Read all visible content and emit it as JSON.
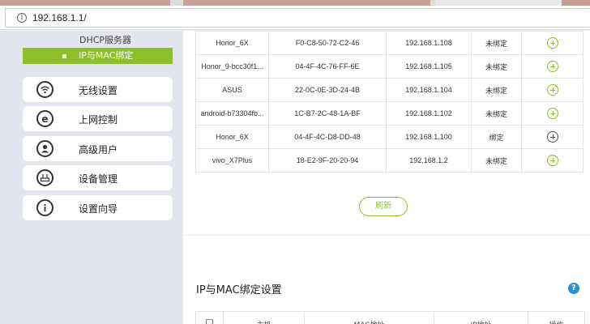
{
  "browser": {
    "url": "192.168.1.1/"
  },
  "sidebar": {
    "sub_items": [
      {
        "label": "DHCP服务器"
      },
      {
        "label": "IP与MAC绑定"
      }
    ],
    "nav_items": [
      {
        "label": "无线设置",
        "icon": "wifi-icon"
      },
      {
        "label": "上网控制",
        "icon": "internet-explorer-icon"
      },
      {
        "label": "高级用户",
        "icon": "user-icon"
      },
      {
        "label": "设备管理",
        "icon": "router-icon"
      },
      {
        "label": "设置向导",
        "icon": "info-icon"
      }
    ]
  },
  "bindings": [
    {
      "name": "Honor_6X",
      "mac": "F0-C8-50-72-C2-46",
      "ip": "192.168.1.108",
      "status": "未绑定"
    },
    {
      "name": "Honor_9-bcc30f1...",
      "mac": "04-4F-4C-76-FF-6E",
      "ip": "192.168.1.105",
      "status": "未绑定"
    },
    {
      "name": "ASUS",
      "mac": "22-0C-0E-3D-24-4B",
      "ip": "192.168.1.104",
      "status": "未绑定"
    },
    {
      "name": "android-b73304fb...",
      "mac": "1C-B7-2C-48-1A-BF",
      "ip": "192.168.1.102",
      "status": "未绑定"
    },
    {
      "name": "Honor_6X",
      "mac": "04-4F-4C-D8-DD-48",
      "ip": "192.168.1.100",
      "status": "绑定"
    },
    {
      "name": "vivo_X7Plus",
      "mac": "18-E2-9F-20-20-94",
      "ip": "192.168.1.2",
      "status": "未绑定"
    }
  ],
  "refresh_label": "刷新",
  "settings": {
    "title": "IP与MAC绑定设置",
    "help": "?",
    "headers": [
      "主机",
      "MAC地址",
      "IP地址",
      "操作"
    ]
  },
  "colors": {
    "accent": "#8cbf2a",
    "help": "#2a8fd6",
    "sidebar_bg": "#e4e6ef"
  }
}
